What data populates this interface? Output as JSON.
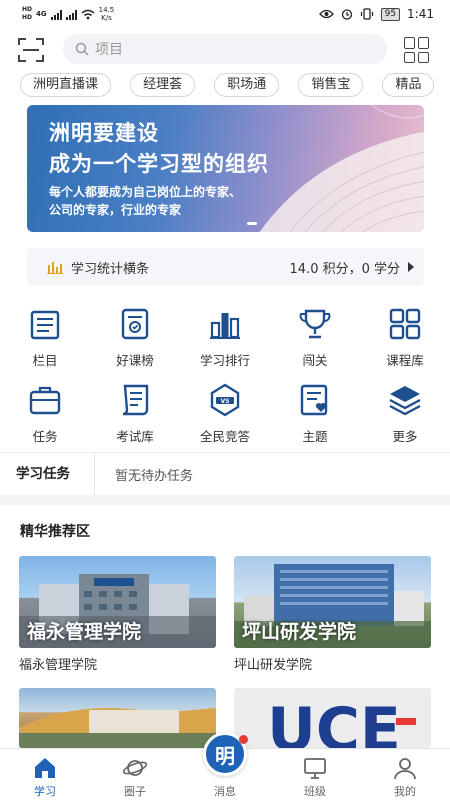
{
  "status_bar": {
    "sim1": "HD",
    "sim2": "HD",
    "net": "4G",
    "speed_value": "14.5",
    "speed_unit": "K/s",
    "battery": "95",
    "time": "1:41"
  },
  "header": {
    "search_placeholder": "项目"
  },
  "categories": [
    "洲明直播课",
    "经理荟",
    "职场通",
    "销售宝",
    "精品"
  ],
  "banner": {
    "line1": "洲明要建设",
    "line2": "成为一个学习型的组织",
    "line3": "每个人都要成为自己岗位上的专家、",
    "line4": "公司的专家，行业的专家"
  },
  "stats": {
    "label": "学习统计横条",
    "value": "14.0 积分，0 学分"
  },
  "functions": [
    {
      "label": "栏目",
      "icon": "column-icon"
    },
    {
      "label": "好课榜",
      "icon": "ranking-list-icon"
    },
    {
      "label": "学习排行",
      "icon": "bar-chart-icon"
    },
    {
      "label": "闯关",
      "icon": "trophy-icon"
    },
    {
      "label": "课程库",
      "icon": "course-library-icon"
    },
    {
      "label": "任务",
      "icon": "briefcase-icon"
    },
    {
      "label": "考试库",
      "icon": "exam-icon"
    },
    {
      "label": "全民竞答",
      "icon": "vs-quiz-icon"
    },
    {
      "label": "主题",
      "icon": "topic-icon"
    },
    {
      "label": "更多",
      "icon": "layers-icon"
    }
  ],
  "task": {
    "label": "学习任务",
    "value": "暂无待办任务"
  },
  "recommend": {
    "title": "精华推荐区",
    "cards": [
      {
        "overlay": "福永管理学院",
        "name": "福永管理学院"
      },
      {
        "overlay": "坪山研发学院",
        "name": "坪山研发学院"
      },
      {
        "overlay": "",
        "name": ""
      },
      {
        "overlay": "UCE",
        "name": ""
      }
    ]
  },
  "tabbar": {
    "items": [
      "学习",
      "圈子",
      "消息",
      "班级",
      "我的"
    ],
    "center_label": "明",
    "active": "学习"
  },
  "colors": {
    "accent": "#1e63b8",
    "badge": "#e53935",
    "stat_icon": "#e0a020"
  }
}
